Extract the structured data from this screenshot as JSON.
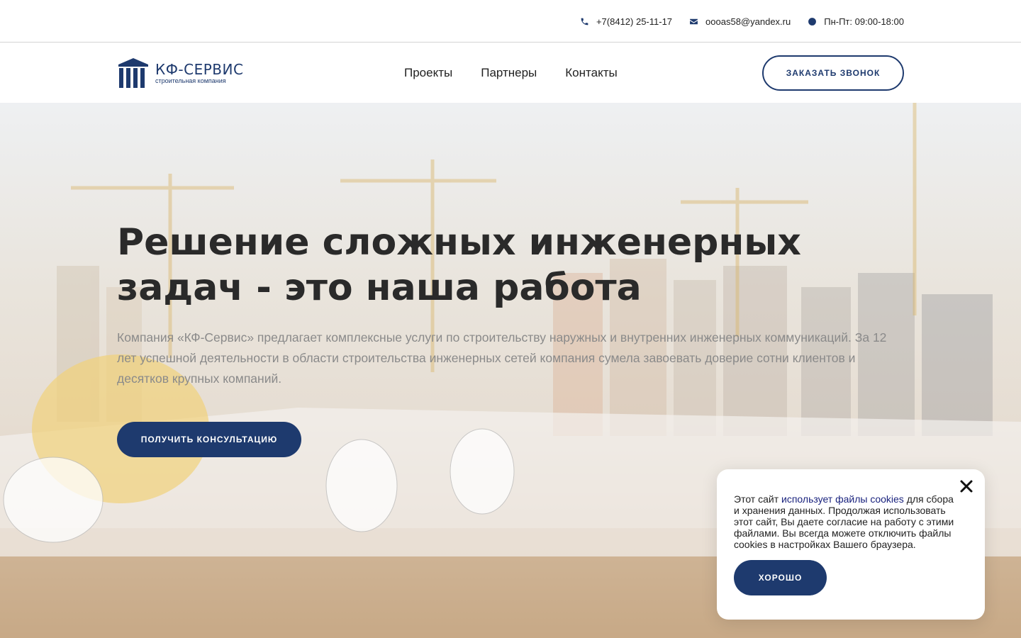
{
  "topbar": {
    "phone": "+7(8412) 25-11-17",
    "email": "oooas58@yandex.ru",
    "hours": "Пн-Пт: 09:00-18:00",
    "icons": [
      "phone-icon",
      "envelope-icon",
      "clock-icon"
    ]
  },
  "header": {
    "logo_name": "КФ-СЕРВИС",
    "logo_sub": "строительная компания",
    "nav": [
      {
        "label": "Проекты"
      },
      {
        "label": "Партнеры"
      },
      {
        "label": "Контакты"
      }
    ],
    "call_button": "ЗАКАЗАТЬ ЗВОНОК"
  },
  "hero": {
    "title": "Решение сложных инженерных задач - это наша работа",
    "description": "Компания «КФ-Сервис» предлагает комплексные услуги по строительству наружных и внутренних инженерных коммуникаций. За 12 лет успешной деятельности в области строительства инженерных сетей компания сумела завоевать доверие сотни клиентов и десятков крупных компаний.",
    "button": "ПОЛУЧИТЬ КОНСУЛЬТАЦИЮ"
  },
  "cookie": {
    "text_before": "Этот сайт ",
    "link": "использует файлы cookies",
    "text_after": " для сбора и хранения данных. Продолжая использовать этот сайт, Вы даете согласие на работу с этими файлами. Вы всегда можете отключить файлы cookies в настройках Вашего браузера.",
    "button": "ХОРОШО"
  },
  "colors": {
    "brand": "#1e3a6e",
    "link": "#1a237e"
  }
}
